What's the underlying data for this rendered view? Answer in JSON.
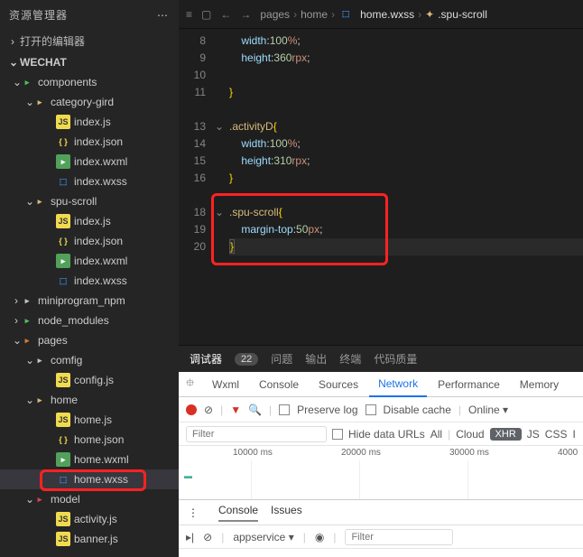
{
  "sidebar": {
    "title": "资源管理器",
    "opened": "打开的编辑器",
    "project": "WECHAT",
    "tree": {
      "components": "components",
      "category_gird": "category-gird",
      "cg_files": [
        "index.js",
        "index.json",
        "index.wxml",
        "index.wxss"
      ],
      "spu_scroll": "spu-scroll",
      "ss_files": [
        "index.js",
        "index.json",
        "index.wxml",
        "index.wxss"
      ],
      "miniprogram_npm": "miniprogram_npm",
      "node_modules": "node_modules",
      "pages": "pages",
      "comfig": "comfig",
      "config_js": "config.js",
      "home": "home",
      "home_files": [
        "home.js",
        "home.json",
        "home.wxml",
        "home.wxss"
      ],
      "model": "model",
      "model_files": [
        "activity.js",
        "banner.js"
      ]
    }
  },
  "breadcrumb": {
    "a": "pages",
    "b": "home",
    "c": "home.wxss",
    "d": ".spu-scroll"
  },
  "code": {
    "lines": [
      "8",
      "9",
      "10",
      "11",
      "",
      "13",
      "14",
      "15",
      "16",
      "",
      "18",
      "19",
      "20"
    ],
    "block1": {
      "p1": "width",
      "v1": "100",
      "u1": "%",
      "p2": "height",
      "v2": "360",
      "u2": "rpx"
    },
    "block2": {
      "sel": ".activityD",
      "p1": "width",
      "v1": "100",
      "u1": "%",
      "p2": "height",
      "v2": "310",
      "u2": "rpx"
    },
    "block3": {
      "sel": ".spu-scroll",
      "p1": "margin-top",
      "v1": "50",
      "u1": "px"
    }
  },
  "debugger": {
    "title": "调试器",
    "count": "22",
    "tabs": [
      "问题",
      "输出",
      "终端",
      "代码质量"
    ]
  },
  "devtools": {
    "tabs": [
      "Wxml",
      "Console",
      "Sources",
      "Network",
      "Performance",
      "Memory"
    ],
    "preserve": "Preserve log",
    "disable": "Disable cache",
    "online": "Online",
    "filter": "Filter",
    "hide": "Hide data URLs",
    "types": [
      "All",
      "Cloud",
      "XHR",
      "JS",
      "CSS",
      "I"
    ],
    "ticks": [
      "10000 ms",
      "20000 ms",
      "30000 ms",
      "4000"
    ],
    "drawer_tabs": [
      "Console",
      "Issues"
    ],
    "service": "appservice",
    "filter2": "Filter"
  }
}
